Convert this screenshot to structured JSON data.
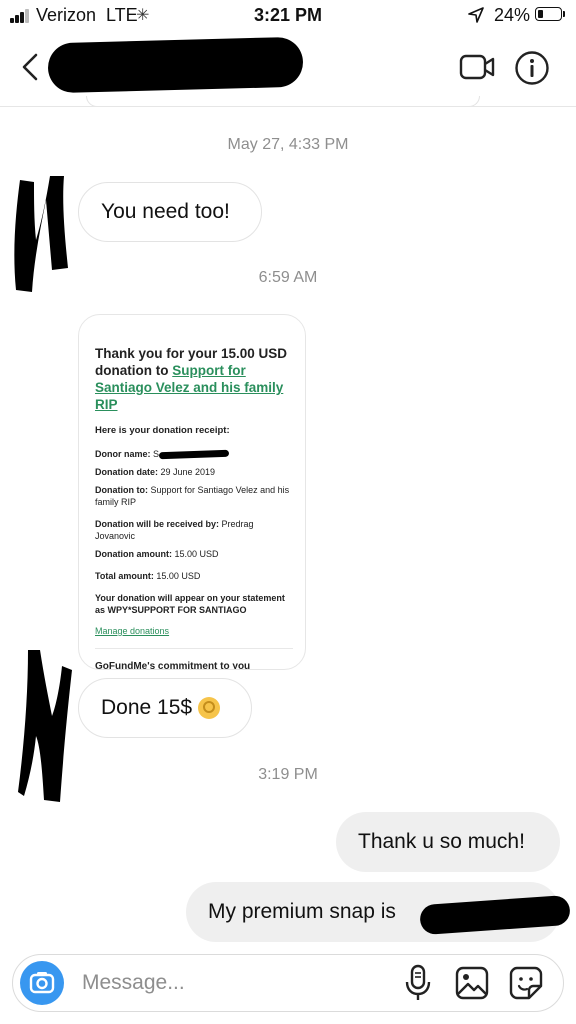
{
  "status_bar": {
    "carrier": "Verizon",
    "network": "LTE",
    "time": "3:21 PM",
    "battery_percent": "24%",
    "battery_level": 0.24
  },
  "header": {
    "icons": [
      "chevron-left-icon",
      "video-camera-icon",
      "info-icon"
    ]
  },
  "thread": {
    "ts1": "May 27, 4:33 PM",
    "msg1": "You need too!",
    "ts2": "6:59 AM",
    "receipt": {
      "title_prefix": "Thank you for your 15.00 USD donation to",
      "title_link": "Support for Santiago Velez and his family RIP",
      "subtitle": "Here is your donation receipt:",
      "donor_name_label": "Donor name:",
      "donor_name_initial": "S",
      "date_label": "Donation date:",
      "date_value": "29 June 2019",
      "to_label": "Donation to:",
      "to_value": "Support for Santiago Velez and his family RIP",
      "recipient_label": "Donation will be received by:",
      "recipient_value": "Predrag Jovanovic",
      "amount_label": "Donation amount:",
      "amount_value": "15.00 USD",
      "total_label": "Total amount:",
      "total_value": "15.00 USD",
      "statement_text": "Your donation will appear on your statement as WPY*SUPPORT FOR SANTIAGO",
      "manage_link": "Manage donations",
      "footer": "GoFundMe's commitment to you"
    },
    "msg2": "Done 15$",
    "ts3": "3:19 PM",
    "msg3": "Thank u so much!",
    "msg4": "My premium snap is"
  },
  "composer": {
    "placeholder": "Message...",
    "icons": [
      "camera-icon",
      "microphone-icon",
      "gallery-icon",
      "sticker-icon"
    ]
  },
  "colors": {
    "accent_blue": "#3897f0",
    "link_green": "#2a8f5c",
    "outgoing_bubble": "#efefef",
    "timestamp_gray": "#8e8e8e"
  }
}
